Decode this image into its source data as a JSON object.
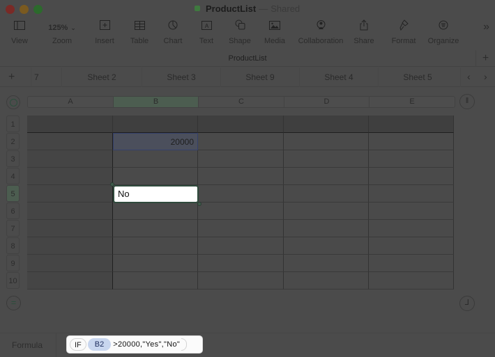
{
  "window": {
    "title": "ProductList",
    "separator": "—",
    "status": "Shared"
  },
  "toolbar": {
    "items": [
      {
        "id": "view",
        "label": "View",
        "icon": "sidebar-icon"
      },
      {
        "id": "zoom",
        "label": "Zoom",
        "value": "125%",
        "icon": "chevron-down-icon"
      },
      {
        "id": "insert",
        "label": "Insert",
        "icon": "insert-icon"
      },
      {
        "id": "table",
        "label": "Table",
        "icon": "table-icon"
      },
      {
        "id": "chart",
        "label": "Chart",
        "icon": "chart-icon"
      },
      {
        "id": "text",
        "label": "Text",
        "icon": "text-box-icon"
      },
      {
        "id": "shape",
        "label": "Shape",
        "icon": "shape-icon"
      },
      {
        "id": "media",
        "label": "Media",
        "icon": "media-icon"
      },
      {
        "id": "collaboration",
        "label": "Collaboration",
        "icon": "collaboration-icon"
      },
      {
        "id": "share",
        "label": "Share",
        "icon": "share-icon"
      },
      {
        "id": "format",
        "label": "Format",
        "icon": "format-brush-icon"
      },
      {
        "id": "organize",
        "label": "Organize",
        "icon": "organize-icon"
      }
    ],
    "more_icon": "»"
  },
  "document": {
    "name": "ProductList"
  },
  "sheets": {
    "tabs": [
      "7",
      "Sheet 2",
      "Sheet 3",
      "Sheet 9",
      "Sheet 4",
      "Sheet 5"
    ],
    "prev": "‹",
    "next": "›",
    "add": "+"
  },
  "table": {
    "columns": [
      "A",
      "B",
      "C",
      "D",
      "E"
    ],
    "selected_column": "B",
    "rows": [
      "1",
      "2",
      "3",
      "4",
      "5",
      "6",
      "7",
      "8",
      "9",
      "10"
    ],
    "selected_row": "5",
    "cells": {
      "B2": "20000",
      "B5": "No"
    }
  },
  "formula_bar": {
    "label": "Formula",
    "function": "IF",
    "reference": "B2",
    "rest": ">20000,\"Yes\",\"No\""
  }
}
